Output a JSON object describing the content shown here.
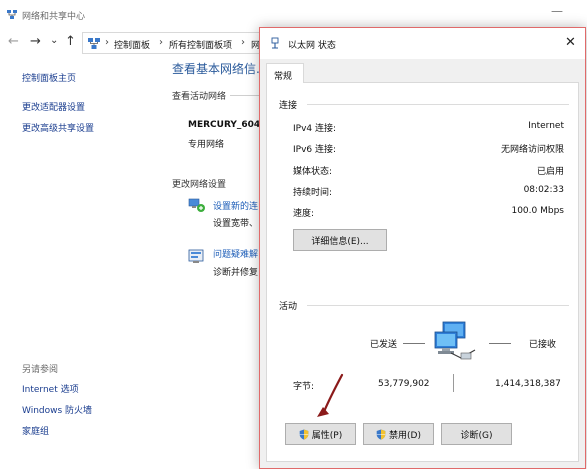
{
  "background_window": {
    "title": "网络和共享中心",
    "minimize_glyph": "—",
    "nav": {
      "back": "←",
      "forward": "→",
      "down": "⌄",
      "up": "↑"
    },
    "breadcrumbs": [
      "控制面板",
      "所有控制面板项",
      "网"
    ],
    "sidebar": {
      "home": "控制面板主页",
      "links": [
        "更改适配器设置",
        "更改高级共享设置"
      ],
      "see_also_label": "另请参阅",
      "see_also": [
        "Internet 选项",
        "Windows 防火墙",
        "家庭组"
      ]
    },
    "main": {
      "title": "查看基本网络信...",
      "active_networks_header": "查看活动网络",
      "network_name": "MERCURY_604",
      "network_type": "专用网络",
      "change_settings_header": "更改网络设置",
      "tasks": [
        {
          "link": "设置新的连",
          "desc": "设置宽带、"
        },
        {
          "link": "问题疑难解",
          "desc": "诊断并修复"
        }
      ]
    }
  },
  "dialog": {
    "title": "以太网 状态",
    "close_glyph": "✕",
    "tab": "常规",
    "connection_header": "连接",
    "connection_rows": [
      {
        "label": "IPv4 连接:",
        "value": "Internet"
      },
      {
        "label": "IPv6 连接:",
        "value": "无网络访问权限"
      },
      {
        "label": "媒体状态:",
        "value": "已启用"
      },
      {
        "label": "持续时间:",
        "value": "08:02:33"
      },
      {
        "label": "速度:",
        "value": "100.0 Mbps"
      }
    ],
    "details_button": "详细信息(E)...",
    "activity_header": "活动",
    "sent_label": "已发送",
    "received_label": "已接收",
    "bytes_label": "字节:",
    "bytes_sent": "53,779,902",
    "bytes_received": "1,414,318,387",
    "buttons": {
      "properties": "属性(P)",
      "disable": "禁用(D)",
      "diagnose": "诊断(G)"
    }
  },
  "colors": {
    "link_blue": "#1e5eb8",
    "title_blue": "#2a5a9b",
    "dialog_border": "#e06a6a",
    "annotation_arrow": "#8b1a1a"
  }
}
